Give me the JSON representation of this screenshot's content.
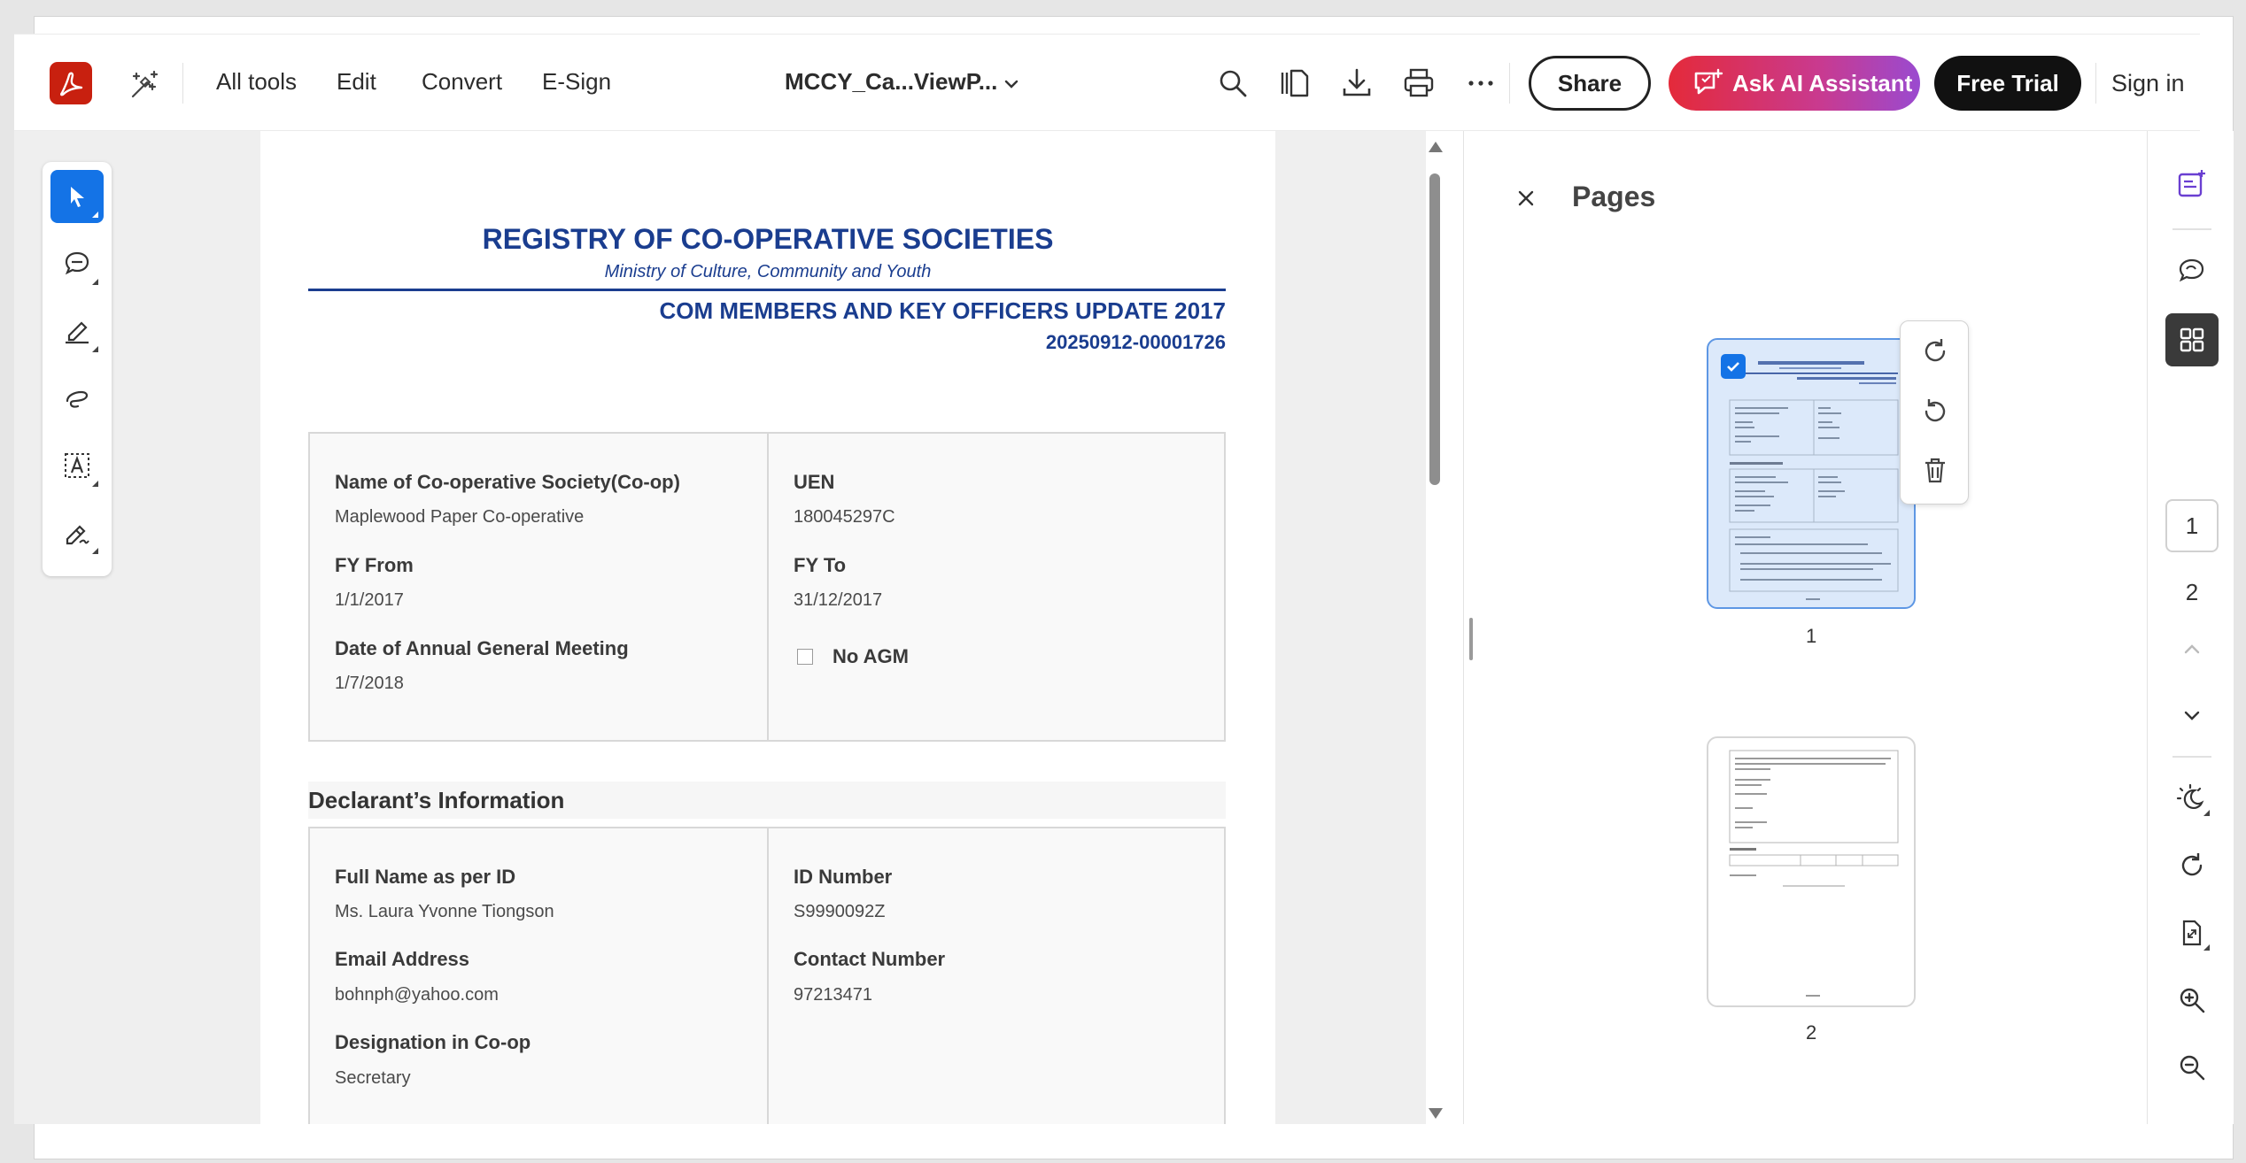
{
  "toolbar": {
    "menu": [
      "All tools",
      "Edit",
      "Convert",
      "E-Sign"
    ],
    "doc_title": "MCCY_Ca...ViewP...",
    "share_label": "Share",
    "ai_label": "Ask AI Assistant",
    "trial_label": "Free Trial",
    "signin_label": "Sign in"
  },
  "document": {
    "registry_title": "REGISTRY OF CO-OPERATIVE SOCIETIES",
    "ministry": "Ministry of Culture, Community and Youth",
    "form_title": "COM MEMBERS AND KEY OFFICERS UPDATE 2017",
    "form_id": "20250912-00001726",
    "coop": {
      "name_label": "Name of Co-operative Society(Co-op)",
      "name_value": "Maplewood Paper Co-operative",
      "uen_label": "UEN",
      "uen_value": "180045297C",
      "fy_from_label": "FY From",
      "fy_from_value": "1/1/2017",
      "fy_to_label": "FY To",
      "fy_to_value": "31/12/2017",
      "agm_label": "Date of Annual General Meeting",
      "agm_value": "1/7/2018",
      "no_agm_label": "No AGM"
    },
    "declarant_heading": "Declarant’s Information",
    "declarant": {
      "fullname_label": "Full Name as per ID",
      "fullname_value": "Ms. Laura Yvonne Tiongson",
      "id_label": "ID Number",
      "id_value": "S9990092Z",
      "email_label": "Email Address",
      "email_value": "bohnph@yahoo.com",
      "contact_label": "Contact Number",
      "contact_value": "97213471",
      "designation_label": "Designation in Co-op",
      "designation_value": "Secretary"
    }
  },
  "pages_panel": {
    "title": "Pages",
    "thumbnails": [
      {
        "label": "1",
        "selected": true
      },
      {
        "label": "2",
        "selected": false
      }
    ]
  },
  "right_rail": {
    "current_page": "1",
    "next_page": "2"
  },
  "colors": {
    "accent": "#1473e6",
    "document_blue": "#1a3d8f",
    "logo_red": "#c8200f"
  }
}
